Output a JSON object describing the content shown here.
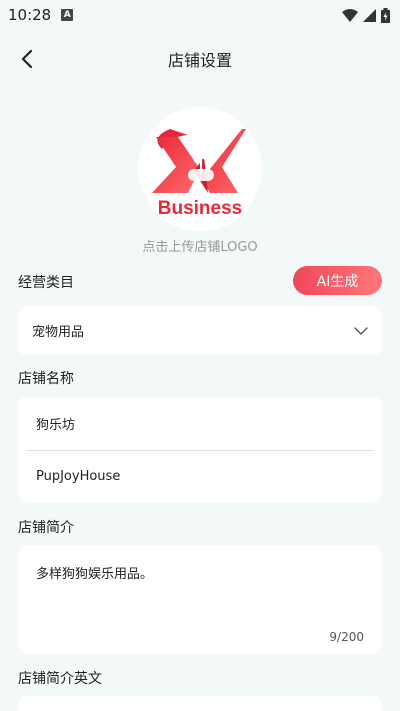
{
  "status": {
    "time": "10:28",
    "notification_glyph": "A"
  },
  "header": {
    "title": "店铺设置"
  },
  "logo": {
    "brand_text": "Business",
    "hint": "点击上传店铺LOGO"
  },
  "category": {
    "label": "经营类目",
    "ai_button": "AI生成",
    "selected": "宠物用品"
  },
  "store_name": {
    "label": "店铺名称",
    "name_cn": "狗乐坊",
    "name_en": "PupJoyHouse"
  },
  "intro": {
    "label": "店铺简介",
    "text": "多样狗狗娱乐用品。",
    "counter": "9/200"
  },
  "intro_en": {
    "label": "店铺简介英文"
  },
  "colors": {
    "accent": "#f0475b",
    "background": "#f3f8f8"
  }
}
